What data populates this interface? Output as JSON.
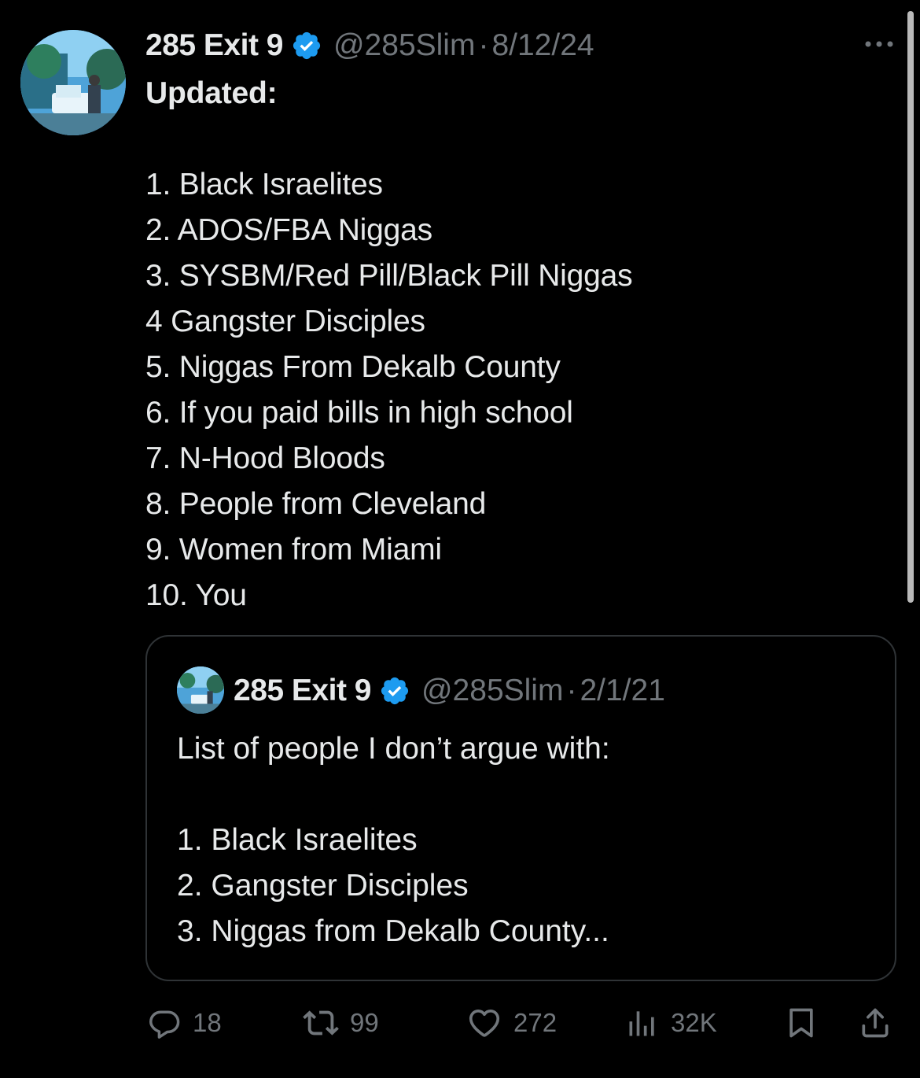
{
  "tweet": {
    "author_name": "285 Exit 9",
    "handle": "@285Slim",
    "separator": "·",
    "date": "8/12/24",
    "text_lines": [
      "Updated:",
      "",
      "1. Black Israelites",
      "2. ADOS/FBA Niggas",
      "3. SYSBM/Red Pill/Black Pill Niggas",
      "4 Gangster Disciples",
      "5. Niggas From Dekalb County",
      "6. If you paid bills in high school",
      "7. N-Hood Bloods",
      "8. People from Cleveland",
      "9. Women from Miami",
      "10. You"
    ]
  },
  "quote": {
    "author_name": "285 Exit 9",
    "handle": "@285Slim",
    "separator": "·",
    "date": "2/1/21",
    "text_lines": [
      "List of people I don’t argue with:",
      "",
      "1. Black Israelites",
      "2. Gangster Disciples",
      "3. Niggas from Dekalb County..."
    ]
  },
  "actions": {
    "reply_count": "18",
    "retweet_count": "99",
    "like_count": "272",
    "views_count": "32K"
  },
  "icons": {
    "verified": "verified-badge-icon",
    "more": "more-icon",
    "reply": "reply-icon",
    "retweet": "retweet-icon",
    "like": "heart-icon",
    "views": "views-icon",
    "bookmark": "bookmark-icon",
    "share": "share-icon"
  },
  "colors": {
    "background": "#000000",
    "text": "#e7e9ea",
    "secondary_text": "#71767b",
    "verified_blue": "#1d9bf0",
    "border": "#2f3336"
  }
}
